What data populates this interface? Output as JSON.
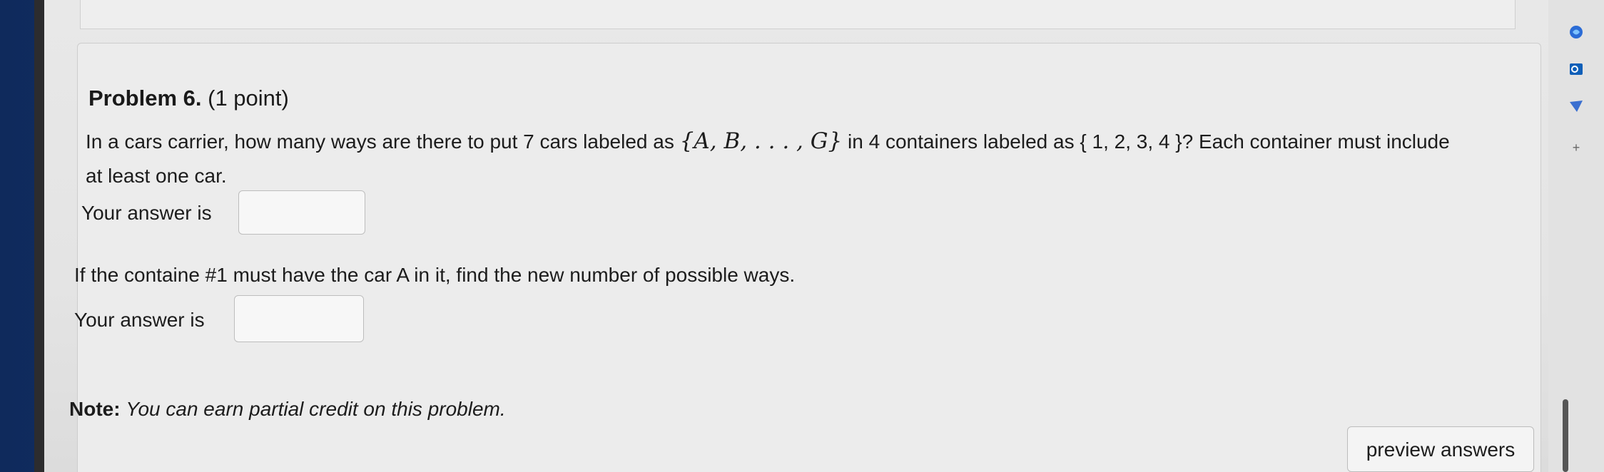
{
  "problem": {
    "title": "Problem 6.",
    "points": "(1 point)"
  },
  "question1": {
    "text_before": "In a cars carrier, how many ways are there to put 7 cars labeled as",
    "math_set": "{A, B, . . . , G}",
    "text_after": "in 4 containers labeled as { 1, 2, 3, 4 }? Each container must include",
    "line2": "at least one car.",
    "answer_label": "Your answer is",
    "answer_value": ""
  },
  "question2": {
    "text": "If the containe #1 must have the car A in it, find the new number of possible ways.",
    "answer_label": "Your answer is",
    "answer_value": ""
  },
  "note": {
    "label": "Note:",
    "text": "You can earn partial credit on this problem."
  },
  "buttons": {
    "preview": "preview answers"
  },
  "side_icons": [
    "copilot-icon",
    "outlook-icon",
    "send-icon",
    "plus-icon"
  ]
}
